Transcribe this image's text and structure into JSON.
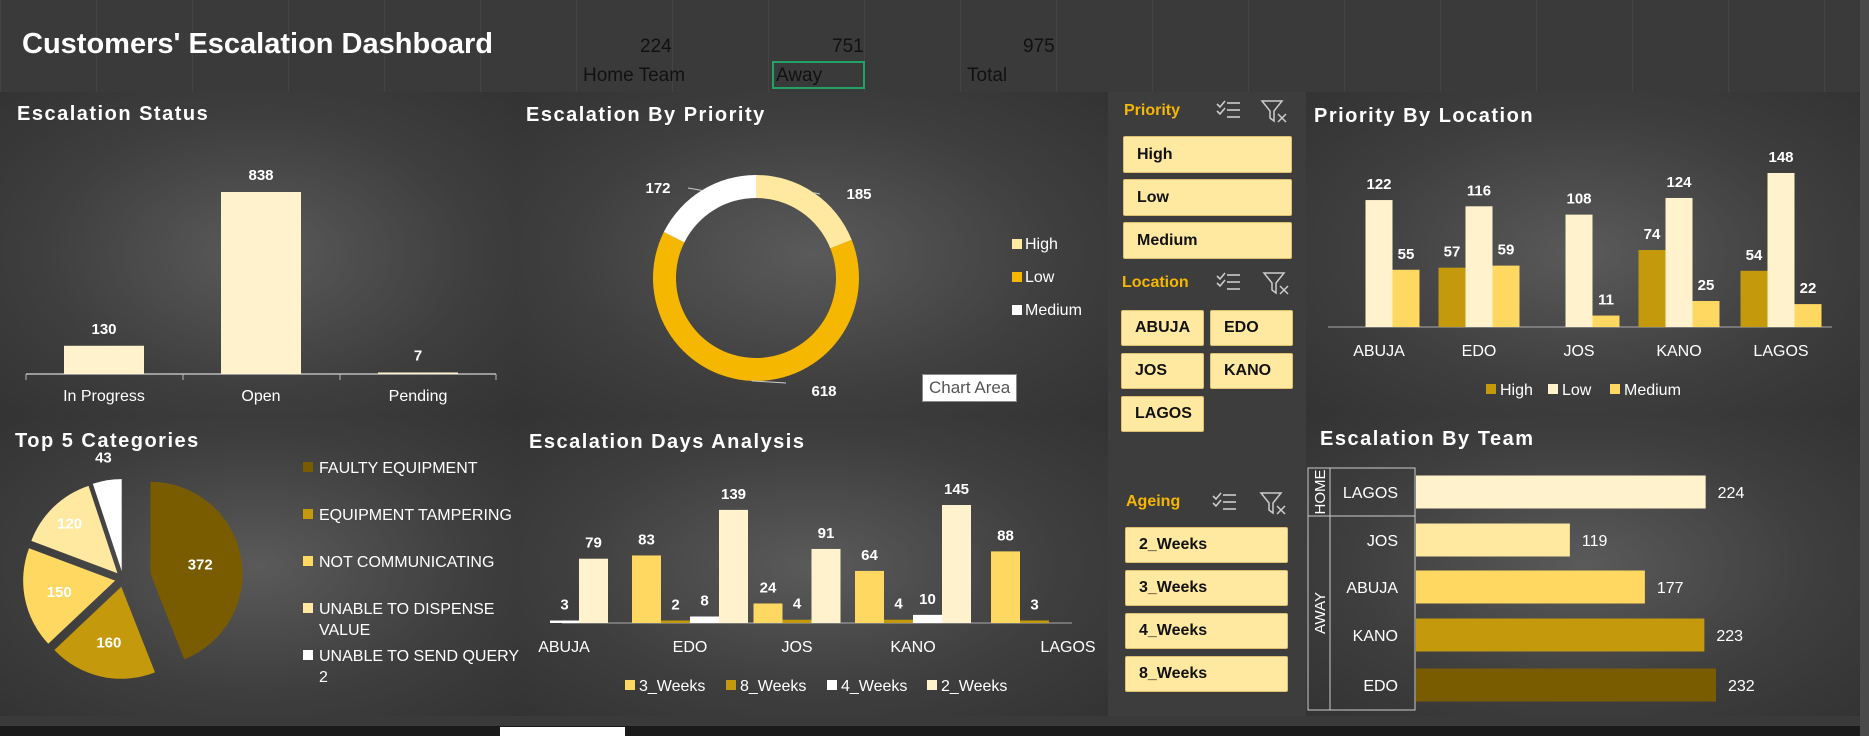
{
  "header": {
    "title": "Customers' Escalation Dashboard",
    "home_count": "224",
    "away_count": "751",
    "total_count": "975",
    "home_label": "Home Team",
    "away_label": "Away",
    "total_label": "Total"
  },
  "colors": {
    "dark": "#7a5c00",
    "mid": "#c49a0c",
    "gold": "#f6b700",
    "yellow": "#ffd862",
    "pale": "#ffe8a0",
    "cream": "#fff2cc",
    "white": "#ffffff"
  },
  "slicers": {
    "priority": {
      "title": "Priority",
      "items": [
        "High",
        "Low",
        "Medium"
      ]
    },
    "location": {
      "title": "Location",
      "items": [
        "ABUJA",
        "EDO",
        "JOS",
        "KANO",
        "LAGOS"
      ]
    },
    "ageing": {
      "title": "Ageing",
      "items": [
        "2_Weeks",
        "3_Weeks",
        "4_Weeks",
        "8_Weeks"
      ]
    },
    "icons": [
      "multi-select-icon",
      "clear-filter-icon"
    ]
  },
  "tooltip": "Chart Area",
  "chart_data": [
    {
      "id": "status",
      "type": "bar",
      "title": "Escalation Status",
      "categories": [
        "In Progress",
        "Open",
        "Pending"
      ],
      "values": [
        130,
        838,
        7
      ],
      "ylim": [
        0,
        838
      ]
    },
    {
      "id": "priority",
      "type": "pie",
      "title": "Escalation By Priority",
      "categories": [
        "High",
        "Low",
        "Medium"
      ],
      "values": [
        185,
        618,
        172
      ]
    },
    {
      "id": "priority_location",
      "type": "bar",
      "title": "Priority By Location",
      "categories": [
        "ABUJA",
        "EDO",
        "JOS",
        "KANO",
        "LAGOS"
      ],
      "series": [
        {
          "name": "High",
          "values": [
            null,
            57,
            null,
            74,
            54
          ]
        },
        {
          "name": "Low",
          "values": [
            122,
            116,
            108,
            124,
            148
          ]
        },
        {
          "name": "Medium",
          "values": [
            55,
            59,
            11,
            25,
            22
          ]
        }
      ]
    },
    {
      "id": "categories",
      "type": "pie",
      "title": "Top 5 Categories",
      "categories": [
        "FAULTY EQUIPMENT",
        "EQUIPMENT TAMPERING",
        "NOT COMMUNICATING",
        "UNABLE TO DISPENSE VALUE",
        "UNABLE TO SEND QUERY 2"
      ],
      "values": [
        372,
        160,
        150,
        120,
        43
      ]
    },
    {
      "id": "days",
      "type": "bar",
      "title": "Escalation Days Analysis",
      "categories": [
        "ABUJA",
        "EDO",
        "JOS",
        "KANO",
        "LAGOS"
      ],
      "series": [
        {
          "name": "3_Weeks",
          "values": [
            null,
            83,
            24,
            64,
            88
          ]
        },
        {
          "name": "8_Weeks",
          "values": [
            null,
            2,
            4,
            4,
            3
          ]
        },
        {
          "name": "4_Weeks",
          "values": [
            3,
            8,
            null,
            10,
            null
          ]
        },
        {
          "name": "2_Weeks",
          "values": [
            79,
            139,
            91,
            145,
            null
          ]
        }
      ]
    },
    {
      "id": "team",
      "type": "bar",
      "title": "Escalation By Team",
      "groups": [
        {
          "name": "HOME",
          "items": [
            "LAGOS"
          ]
        },
        {
          "name": "AWAY",
          "items": [
            "JOS",
            "ABUJA",
            "KANO",
            "EDO"
          ]
        }
      ],
      "categories": [
        "LAGOS",
        "JOS",
        "ABUJA",
        "KANO",
        "EDO"
      ],
      "values": [
        224,
        119,
        177,
        223,
        232
      ]
    }
  ]
}
